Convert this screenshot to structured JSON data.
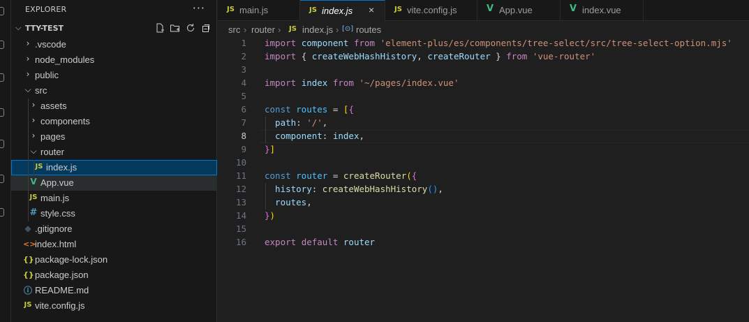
{
  "sidebar": {
    "title": "EXPLORER",
    "more": "···",
    "project": "TTY-TEST",
    "tree": [
      {
        "label": ".vscode",
        "kind": "folder",
        "open": false,
        "depth": 1,
        "icon": ""
      },
      {
        "label": "node_modules",
        "kind": "folder",
        "open": false,
        "depth": 1,
        "icon": ""
      },
      {
        "label": "public",
        "kind": "folder",
        "open": false,
        "depth": 1,
        "icon": ""
      },
      {
        "label": "src",
        "kind": "folder",
        "open": true,
        "depth": 1,
        "icon": ""
      },
      {
        "label": "assets",
        "kind": "folder",
        "open": false,
        "depth": 2,
        "icon": ""
      },
      {
        "label": "components",
        "kind": "folder",
        "open": false,
        "depth": 2,
        "icon": ""
      },
      {
        "label": "pages",
        "kind": "folder",
        "open": false,
        "depth": 2,
        "icon": ""
      },
      {
        "label": "router",
        "kind": "folder",
        "open": true,
        "depth": 2,
        "icon": ""
      },
      {
        "label": "index.js",
        "kind": "file",
        "depth": 3,
        "icon": "JS",
        "type": "js",
        "selected": true
      },
      {
        "label": "App.vue",
        "kind": "file",
        "depth": 2,
        "icon": "V",
        "type": "vue",
        "hover": true
      },
      {
        "label": "main.js",
        "kind": "file",
        "depth": 2,
        "icon": "JS",
        "type": "js"
      },
      {
        "label": "style.css",
        "kind": "file",
        "depth": 2,
        "icon": "#",
        "type": "css"
      },
      {
        "label": ".gitignore",
        "kind": "file",
        "depth": 1,
        "icon": "◆",
        "type": "git"
      },
      {
        "label": "index.html",
        "kind": "file",
        "depth": 1,
        "icon": "<>",
        "type": "html"
      },
      {
        "label": "package-lock.json",
        "kind": "file",
        "depth": 1,
        "icon": "{}",
        "type": "json"
      },
      {
        "label": "package.json",
        "kind": "file",
        "depth": 1,
        "icon": "{}",
        "type": "json"
      },
      {
        "label": "README.md",
        "kind": "file",
        "depth": 1,
        "icon": "ⓘ",
        "type": "md"
      },
      {
        "label": "vite.config.js",
        "kind": "file",
        "depth": 1,
        "icon": "JS",
        "type": "js"
      }
    ]
  },
  "tabs": [
    {
      "label": "main.js",
      "icon": "JS",
      "type": "js",
      "active": false
    },
    {
      "label": "index.js",
      "icon": "JS",
      "type": "js",
      "active": true,
      "close": "×"
    },
    {
      "label": "vite.config.js",
      "icon": "JS",
      "type": "js",
      "active": false
    },
    {
      "label": "App.vue",
      "icon": "V",
      "type": "vue",
      "active": false
    },
    {
      "label": "index.vue",
      "icon": "V",
      "type": "vue",
      "active": false
    }
  ],
  "breadcrumb": {
    "parts": [
      "src",
      "router",
      "index.js",
      "routes"
    ],
    "file_icon": "JS",
    "symbol_icon": "[⊙]"
  },
  "editor": {
    "current_line": 8,
    "lines": [
      [
        [
          "import ",
          "#c586c0"
        ],
        [
          "component ",
          "#9cdcfe"
        ],
        [
          "from ",
          "#c586c0"
        ],
        [
          "'element-plus/es/components/tree-select/src/tree-select-option.mjs'",
          "#ce9178"
        ]
      ],
      [
        [
          "import ",
          "#c586c0"
        ],
        [
          "{ ",
          "#d4d4d4"
        ],
        [
          "createWebHashHistory",
          "#9cdcfe"
        ],
        [
          ", ",
          "#d4d4d4"
        ],
        [
          "createRouter",
          "#9cdcfe"
        ],
        [
          " } ",
          "#d4d4d4"
        ],
        [
          "from ",
          "#c586c0"
        ],
        [
          "'vue-router'",
          "#ce9178"
        ]
      ],
      [],
      [
        [
          "import ",
          "#c586c0"
        ],
        [
          "index ",
          "#9cdcfe"
        ],
        [
          "from ",
          "#c586c0"
        ],
        [
          "'~/pages/index.vue'",
          "#ce9178"
        ]
      ],
      [],
      [
        [
          "const ",
          "#569cd6"
        ],
        [
          "routes ",
          "#4fc1ff"
        ],
        [
          "= ",
          "#d4d4d4"
        ],
        [
          "[",
          "#ffd700"
        ],
        [
          "{",
          "#da70d6"
        ]
      ],
      [
        [
          "  path",
          "#9cdcfe"
        ],
        [
          ": ",
          "#d4d4d4"
        ],
        [
          "'/'",
          "#ce9178"
        ],
        [
          ",",
          "#d4d4d4"
        ]
      ],
      [
        [
          "  component",
          "#9cdcfe"
        ],
        [
          ": ",
          "#d4d4d4"
        ],
        [
          "index",
          "#9cdcfe"
        ],
        [
          ",",
          "#d4d4d4"
        ]
      ],
      [
        [
          "}",
          "#da70d6"
        ],
        [
          "]",
          "#ffd700"
        ]
      ],
      [],
      [
        [
          "const ",
          "#569cd6"
        ],
        [
          "router ",
          "#4fc1ff"
        ],
        [
          "= ",
          "#d4d4d4"
        ],
        [
          "createRouter",
          "#dcdcaa"
        ],
        [
          "(",
          "#ffd700"
        ],
        [
          "{",
          "#da70d6"
        ]
      ],
      [
        [
          "  history",
          "#9cdcfe"
        ],
        [
          ": ",
          "#d4d4d4"
        ],
        [
          "createWebHashHistory",
          "#dcdcaa"
        ],
        [
          "()",
          "#179fff"
        ],
        [
          ",",
          "#d4d4d4"
        ]
      ],
      [
        [
          "  routes",
          "#9cdcfe"
        ],
        [
          ",",
          "#d4d4d4"
        ]
      ],
      [
        [
          "}",
          "#da70d6"
        ],
        [
          ")",
          "#ffd700"
        ]
      ],
      [],
      [
        [
          "export ",
          "#c586c0"
        ],
        [
          "default ",
          "#c586c0"
        ],
        [
          "router",
          "#9cdcfe"
        ]
      ]
    ]
  },
  "colors": {
    "accent": "#0078d4",
    "selection": "#04395e",
    "js": "#cbcb41",
    "vue": "#41b883"
  }
}
